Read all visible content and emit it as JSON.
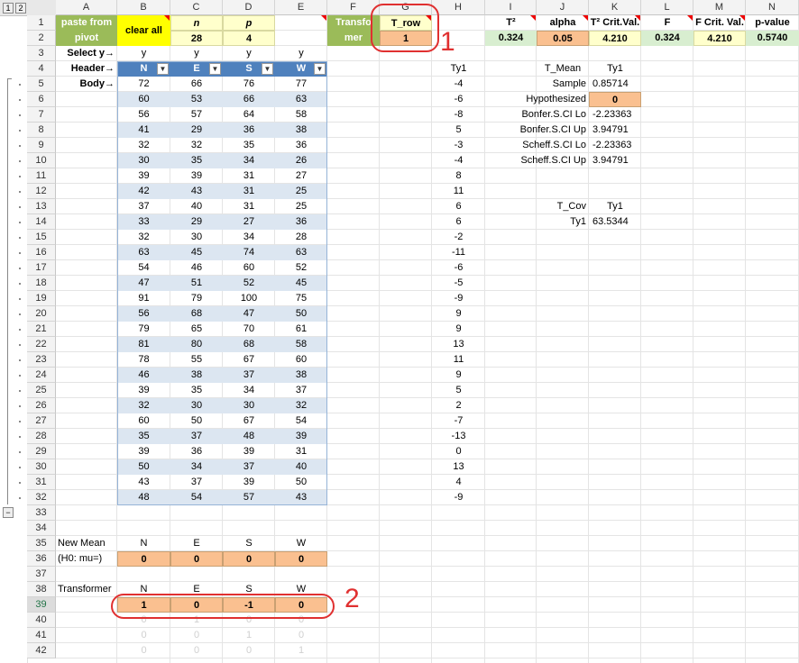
{
  "outline": {
    "level1": "1",
    "level2": "2",
    "collapse": "−"
  },
  "columns": [
    "A",
    "B",
    "C",
    "D",
    "E",
    "F",
    "G",
    "H",
    "I",
    "J",
    "K",
    "L",
    "M",
    "N"
  ],
  "rows": [
    "1",
    "2",
    "3",
    "4",
    "5",
    "6",
    "7",
    "8",
    "9",
    "10",
    "11",
    "12",
    "13",
    "14",
    "15",
    "16",
    "17",
    "18",
    "19",
    "20",
    "21",
    "22",
    "23",
    "24",
    "25",
    "26",
    "27",
    "28",
    "29",
    "30",
    "31",
    "32",
    "33",
    "34",
    "35",
    "36",
    "37",
    "38",
    "39",
    "40",
    "41",
    "42"
  ],
  "buttons": {
    "paste_from_pivot": "paste from pivot",
    "clear_all": "clear all"
  },
  "params": {
    "n_label": "n",
    "p_label": "p",
    "n_value": "28",
    "p_value": "4"
  },
  "transformer": {
    "label_line1": "Transfo",
    "label_line2": "mer",
    "t_row_label": "T_row",
    "t_row_value": "1"
  },
  "stats": {
    "headers": [
      "T²",
      "alpha",
      "T² Crit.Val.",
      "F",
      "F Crit. Val.",
      "p-value"
    ],
    "values": [
      "0.324",
      "0.05",
      "4.210",
      "0.324",
      "4.210",
      "0.5740"
    ]
  },
  "row_labels": {
    "select_y": "Select y→",
    "header": "Header→",
    "body": "Body→"
  },
  "select_y": [
    "y",
    "y",
    "y",
    "y"
  ],
  "headers": [
    "N",
    "E",
    "S",
    "W"
  ],
  "body": [
    [
      "72",
      "66",
      "76",
      "77"
    ],
    [
      "60",
      "53",
      "66",
      "63"
    ],
    [
      "56",
      "57",
      "64",
      "58"
    ],
    [
      "41",
      "29",
      "36",
      "38"
    ],
    [
      "32",
      "32",
      "35",
      "36"
    ],
    [
      "30",
      "35",
      "34",
      "26"
    ],
    [
      "39",
      "39",
      "31",
      "27"
    ],
    [
      "42",
      "43",
      "31",
      "25"
    ],
    [
      "37",
      "40",
      "31",
      "25"
    ],
    [
      "33",
      "29",
      "27",
      "36"
    ],
    [
      "32",
      "30",
      "34",
      "28"
    ],
    [
      "63",
      "45",
      "74",
      "63"
    ],
    [
      "54",
      "46",
      "60",
      "52"
    ],
    [
      "47",
      "51",
      "52",
      "45"
    ],
    [
      "91",
      "79",
      "100",
      "75"
    ],
    [
      "56",
      "68",
      "47",
      "50"
    ],
    [
      "79",
      "65",
      "70",
      "61"
    ],
    [
      "81",
      "80",
      "68",
      "58"
    ],
    [
      "78",
      "55",
      "67",
      "60"
    ],
    [
      "46",
      "38",
      "37",
      "38"
    ],
    [
      "39",
      "35",
      "34",
      "37"
    ],
    [
      "32",
      "30",
      "30",
      "32"
    ],
    [
      "60",
      "50",
      "67",
      "54"
    ],
    [
      "35",
      "37",
      "48",
      "39"
    ],
    [
      "39",
      "36",
      "39",
      "31"
    ],
    [
      "50",
      "34",
      "37",
      "40"
    ],
    [
      "43",
      "37",
      "39",
      "50"
    ],
    [
      "48",
      "54",
      "57",
      "43"
    ]
  ],
  "ty1": {
    "header": "Ty1",
    "values": [
      "-4",
      "-6",
      "-8",
      "5",
      "-3",
      "-4",
      "8",
      "11",
      "6",
      "6",
      "-2",
      "-11",
      "-6",
      "-5",
      "-9",
      "9",
      "9",
      "13",
      "11",
      "9",
      "5",
      "2",
      "-7",
      "-13",
      "0",
      "13",
      "4",
      "-9"
    ]
  },
  "t_mean": {
    "title": "T_Mean",
    "col": "Ty1",
    "rows": [
      {
        "label": "Sample",
        "value": "0.85714"
      },
      {
        "label": "Hypothesized",
        "value": "0"
      },
      {
        "label": "Bonfer.S.CI Lo",
        "value": "-2.23363"
      },
      {
        "label": "Bonfer.S.CI Up",
        "value": "3.94791"
      },
      {
        "label": "Scheff.S.CI Lo",
        "value": "-2.23363"
      },
      {
        "label": "Scheff.S.CI Up",
        "value": "3.94791"
      }
    ]
  },
  "t_cov": {
    "title": "T_Cov",
    "col": "Ty1",
    "row_label": "Ty1",
    "value": "63.5344"
  },
  "new_mean": {
    "label": "New Mean",
    "h0_label": "(H0: mu=)",
    "headers": [
      "N",
      "E",
      "S",
      "W"
    ],
    "values": [
      "0",
      "0",
      "0",
      "0"
    ]
  },
  "transformer_matrix": {
    "label": "Transformer",
    "headers": [
      "N",
      "E",
      "S",
      "W"
    ],
    "row39": [
      "1",
      "0",
      "-1",
      "0"
    ],
    "row40": [
      "0",
      "1",
      "0",
      "0"
    ],
    "row41": [
      "0",
      "0",
      "1",
      "0"
    ],
    "row42": [
      "0",
      "0",
      "0",
      "1"
    ]
  },
  "annotations": {
    "one": "1",
    "two": "2"
  },
  "colors": {
    "accent_red": "#e03030",
    "header_blue": "#4f81bd",
    "input_peach": "#fac090",
    "title_green": "#9bbb59"
  }
}
